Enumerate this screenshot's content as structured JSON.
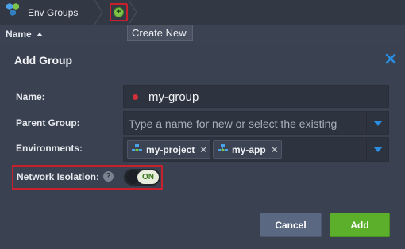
{
  "breadcrumb": {
    "env_groups_label": "Env Groups",
    "env_groups_icon": "hexagon-cluster-icon",
    "create_icon": "plus-circle-icon"
  },
  "grid": {
    "name_column_label": "Name",
    "sort_direction": "ascending"
  },
  "tooltip": {
    "text": "Create New"
  },
  "dialog": {
    "title": "Add Group",
    "close_icon": "close-icon",
    "name": {
      "label": "Name:",
      "value": "my-group",
      "required_indicator_color": "#d32f3a"
    },
    "parent_group": {
      "label": "Parent Group:",
      "value": "",
      "placeholder": "Type a name for new or select the existing"
    },
    "environments": {
      "label": "Environments:",
      "tags": [
        {
          "label": "my-project",
          "icon": "environment-topology-icon"
        },
        {
          "label": "my-app",
          "icon": "environment-topology-icon"
        }
      ]
    },
    "network_isolation": {
      "label": "Network Isolation:",
      "help_glyph": "?",
      "toggle_text": "ON",
      "enabled": true
    },
    "buttons": {
      "cancel": "Cancel",
      "add": "Add"
    }
  },
  "colors": {
    "accent_blue": "#2b8de0",
    "add_green": "#5caf2b",
    "highlight_red": "#c8202c"
  }
}
